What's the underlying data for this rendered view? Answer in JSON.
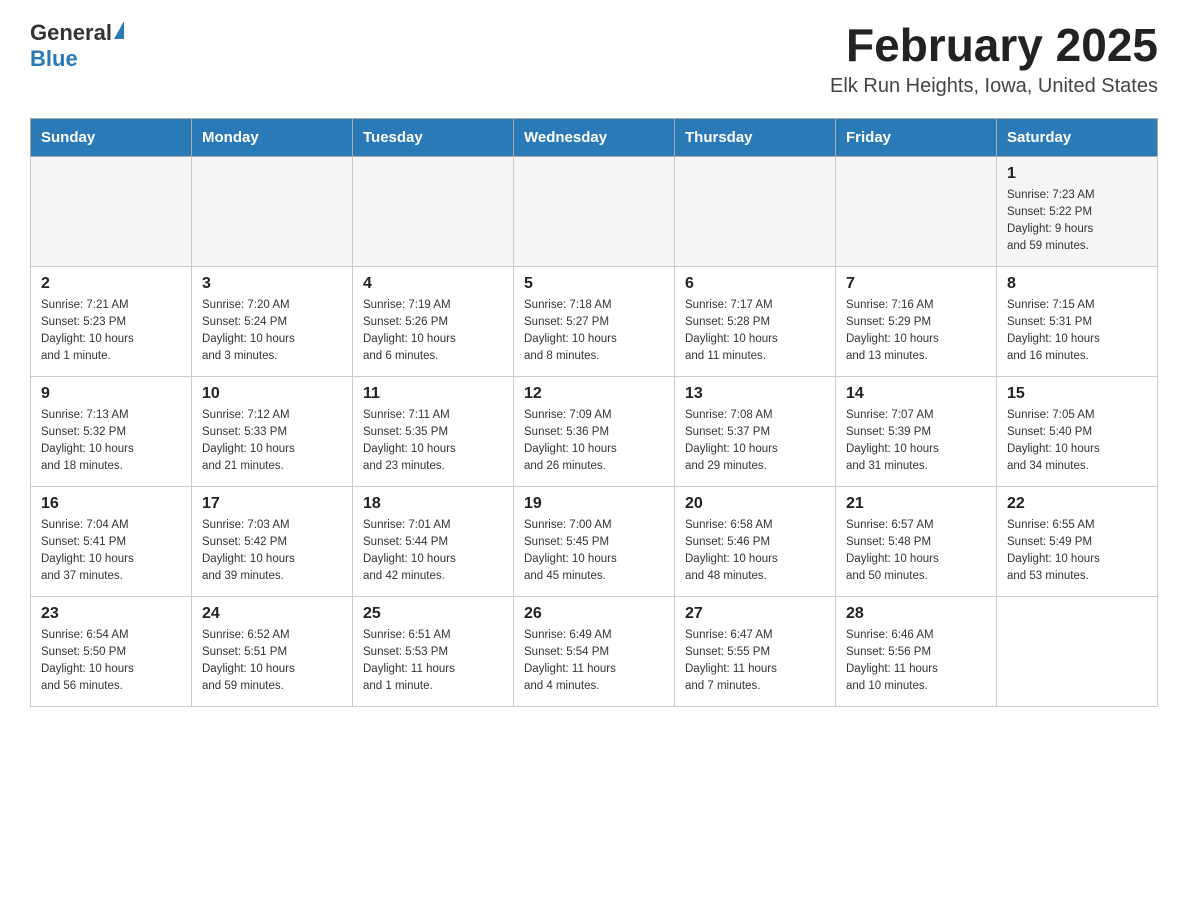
{
  "header": {
    "logo_general": "General",
    "logo_blue": "Blue",
    "month_title": "February 2025",
    "location": "Elk Run Heights, Iowa, United States"
  },
  "days_of_week": [
    "Sunday",
    "Monday",
    "Tuesday",
    "Wednesday",
    "Thursday",
    "Friday",
    "Saturday"
  ],
  "weeks": [
    [
      {
        "day": "",
        "info": ""
      },
      {
        "day": "",
        "info": ""
      },
      {
        "day": "",
        "info": ""
      },
      {
        "day": "",
        "info": ""
      },
      {
        "day": "",
        "info": ""
      },
      {
        "day": "",
        "info": ""
      },
      {
        "day": "1",
        "info": "Sunrise: 7:23 AM\nSunset: 5:22 PM\nDaylight: 9 hours\nand 59 minutes."
      }
    ],
    [
      {
        "day": "2",
        "info": "Sunrise: 7:21 AM\nSunset: 5:23 PM\nDaylight: 10 hours\nand 1 minute."
      },
      {
        "day": "3",
        "info": "Sunrise: 7:20 AM\nSunset: 5:24 PM\nDaylight: 10 hours\nand 3 minutes."
      },
      {
        "day": "4",
        "info": "Sunrise: 7:19 AM\nSunset: 5:26 PM\nDaylight: 10 hours\nand 6 minutes."
      },
      {
        "day": "5",
        "info": "Sunrise: 7:18 AM\nSunset: 5:27 PM\nDaylight: 10 hours\nand 8 minutes."
      },
      {
        "day": "6",
        "info": "Sunrise: 7:17 AM\nSunset: 5:28 PM\nDaylight: 10 hours\nand 11 minutes."
      },
      {
        "day": "7",
        "info": "Sunrise: 7:16 AM\nSunset: 5:29 PM\nDaylight: 10 hours\nand 13 minutes."
      },
      {
        "day": "8",
        "info": "Sunrise: 7:15 AM\nSunset: 5:31 PM\nDaylight: 10 hours\nand 16 minutes."
      }
    ],
    [
      {
        "day": "9",
        "info": "Sunrise: 7:13 AM\nSunset: 5:32 PM\nDaylight: 10 hours\nand 18 minutes."
      },
      {
        "day": "10",
        "info": "Sunrise: 7:12 AM\nSunset: 5:33 PM\nDaylight: 10 hours\nand 21 minutes."
      },
      {
        "day": "11",
        "info": "Sunrise: 7:11 AM\nSunset: 5:35 PM\nDaylight: 10 hours\nand 23 minutes."
      },
      {
        "day": "12",
        "info": "Sunrise: 7:09 AM\nSunset: 5:36 PM\nDaylight: 10 hours\nand 26 minutes."
      },
      {
        "day": "13",
        "info": "Sunrise: 7:08 AM\nSunset: 5:37 PM\nDaylight: 10 hours\nand 29 minutes."
      },
      {
        "day": "14",
        "info": "Sunrise: 7:07 AM\nSunset: 5:39 PM\nDaylight: 10 hours\nand 31 minutes."
      },
      {
        "day": "15",
        "info": "Sunrise: 7:05 AM\nSunset: 5:40 PM\nDaylight: 10 hours\nand 34 minutes."
      }
    ],
    [
      {
        "day": "16",
        "info": "Sunrise: 7:04 AM\nSunset: 5:41 PM\nDaylight: 10 hours\nand 37 minutes."
      },
      {
        "day": "17",
        "info": "Sunrise: 7:03 AM\nSunset: 5:42 PM\nDaylight: 10 hours\nand 39 minutes."
      },
      {
        "day": "18",
        "info": "Sunrise: 7:01 AM\nSunset: 5:44 PM\nDaylight: 10 hours\nand 42 minutes."
      },
      {
        "day": "19",
        "info": "Sunrise: 7:00 AM\nSunset: 5:45 PM\nDaylight: 10 hours\nand 45 minutes."
      },
      {
        "day": "20",
        "info": "Sunrise: 6:58 AM\nSunset: 5:46 PM\nDaylight: 10 hours\nand 48 minutes."
      },
      {
        "day": "21",
        "info": "Sunrise: 6:57 AM\nSunset: 5:48 PM\nDaylight: 10 hours\nand 50 minutes."
      },
      {
        "day": "22",
        "info": "Sunrise: 6:55 AM\nSunset: 5:49 PM\nDaylight: 10 hours\nand 53 minutes."
      }
    ],
    [
      {
        "day": "23",
        "info": "Sunrise: 6:54 AM\nSunset: 5:50 PM\nDaylight: 10 hours\nand 56 minutes."
      },
      {
        "day": "24",
        "info": "Sunrise: 6:52 AM\nSunset: 5:51 PM\nDaylight: 10 hours\nand 59 minutes."
      },
      {
        "day": "25",
        "info": "Sunrise: 6:51 AM\nSunset: 5:53 PM\nDaylight: 11 hours\nand 1 minute."
      },
      {
        "day": "26",
        "info": "Sunrise: 6:49 AM\nSunset: 5:54 PM\nDaylight: 11 hours\nand 4 minutes."
      },
      {
        "day": "27",
        "info": "Sunrise: 6:47 AM\nSunset: 5:55 PM\nDaylight: 11 hours\nand 7 minutes."
      },
      {
        "day": "28",
        "info": "Sunrise: 6:46 AM\nSunset: 5:56 PM\nDaylight: 11 hours\nand 10 minutes."
      },
      {
        "day": "",
        "info": ""
      }
    ]
  ]
}
